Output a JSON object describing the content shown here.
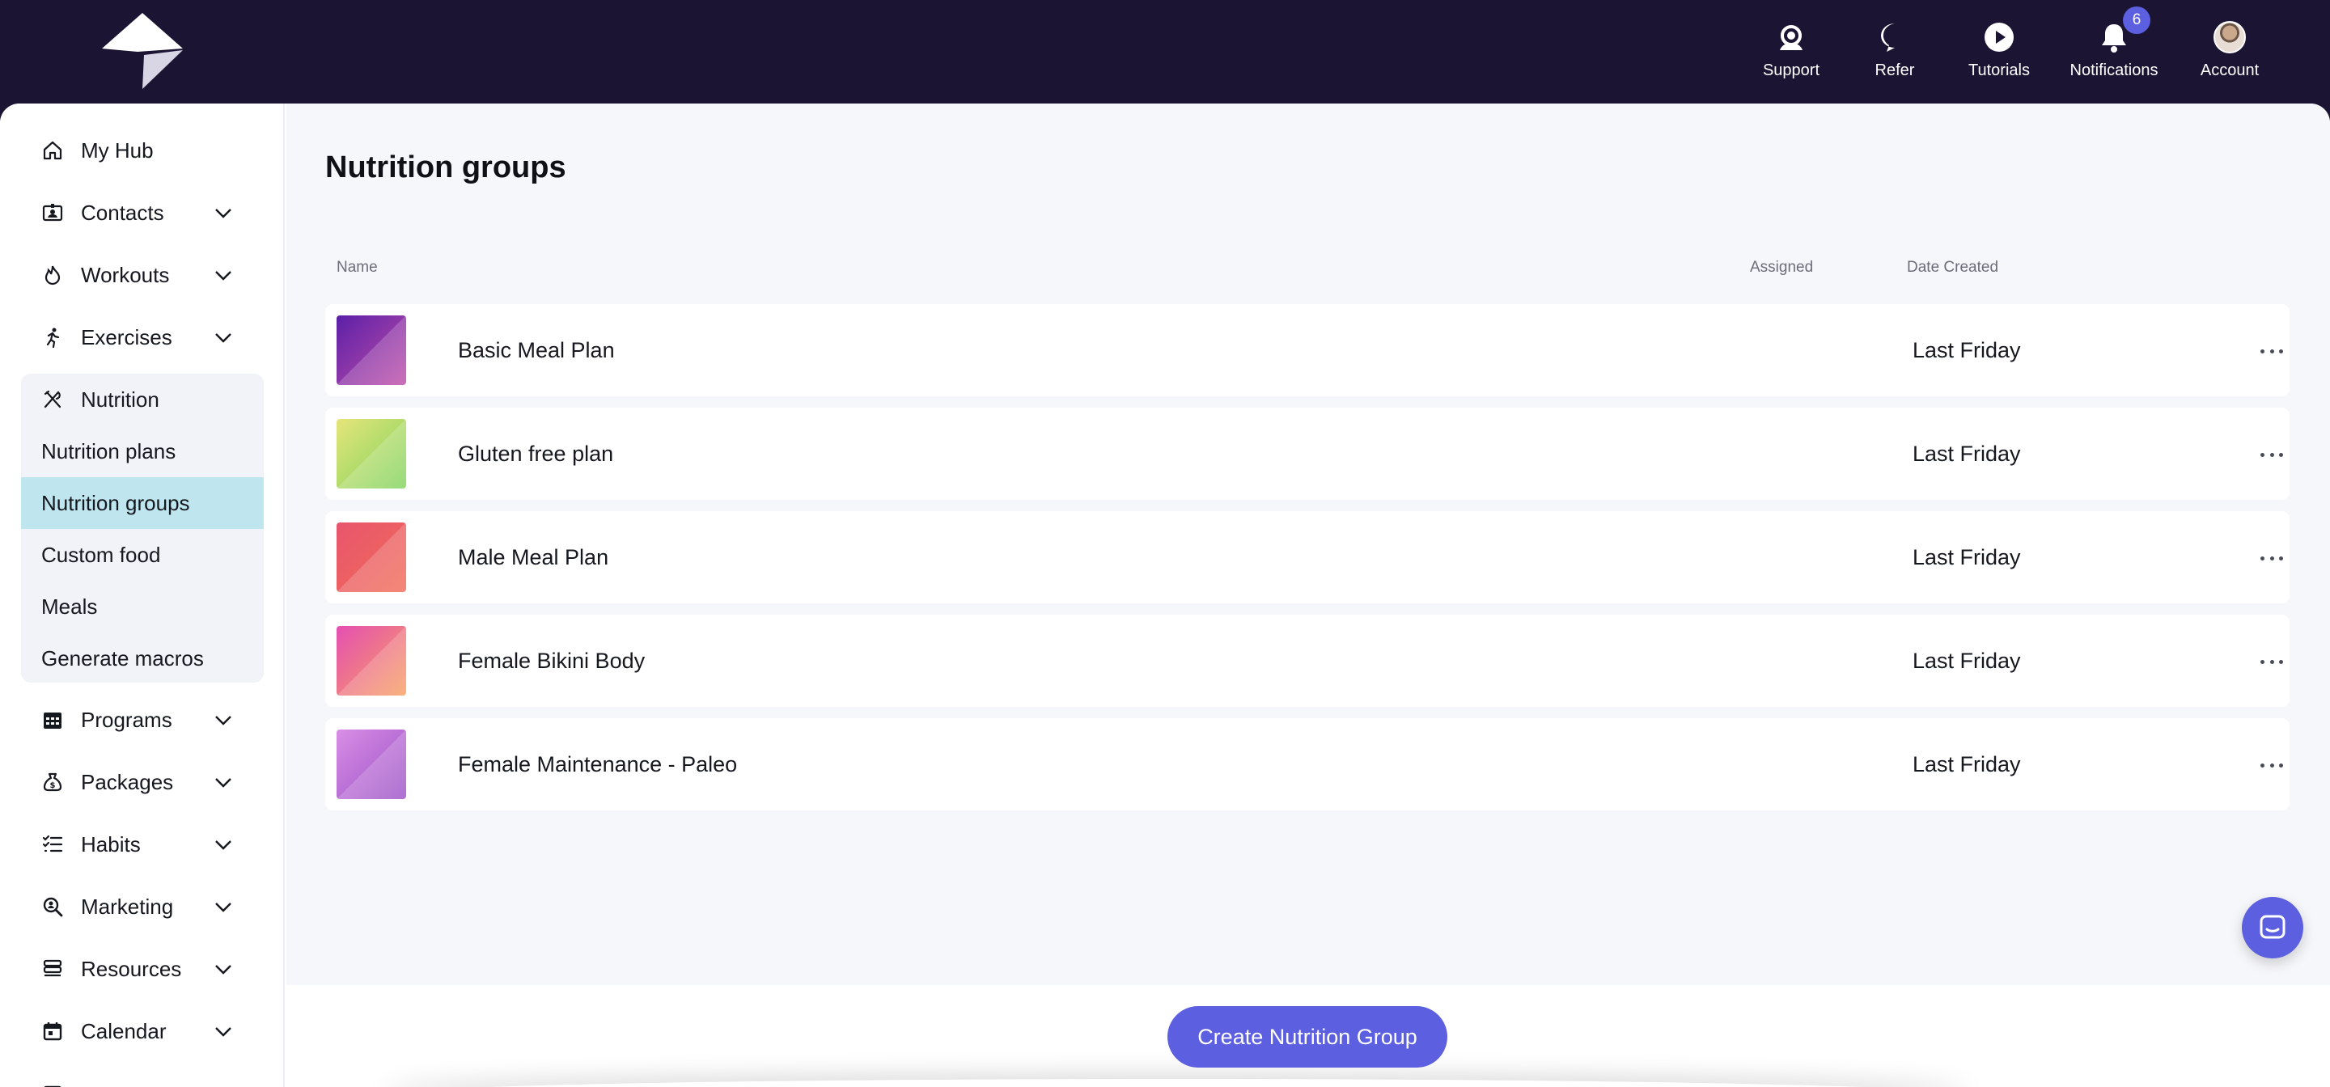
{
  "header": {
    "nav": [
      {
        "key": "support",
        "label": "Support",
        "icon": "headset-icon"
      },
      {
        "key": "refer",
        "label": "Refer",
        "icon": "dollar-chat-icon"
      },
      {
        "key": "tutorials",
        "label": "Tutorials",
        "icon": "play-circle-icon"
      },
      {
        "key": "notifications",
        "label": "Notifications",
        "icon": "bell-icon",
        "badge": "6"
      },
      {
        "key": "account",
        "label": "Account",
        "icon": "avatar"
      }
    ]
  },
  "sidebar": {
    "items": [
      {
        "label": "My Hub",
        "icon": "home-icon"
      },
      {
        "label": "Contacts",
        "icon": "contact-card-icon"
      },
      {
        "label": "Workouts",
        "icon": "flame-icon"
      },
      {
        "label": "Exercises",
        "icon": "runner-icon"
      },
      {
        "label": "Nutrition",
        "icon": "utensils-icon"
      },
      {
        "label": "Programs",
        "icon": "calendar-grid-icon"
      },
      {
        "label": "Packages",
        "icon": "moneybag-icon"
      },
      {
        "label": "Habits",
        "icon": "checklist-icon"
      },
      {
        "label": "Marketing",
        "icon": "magnify-icon"
      },
      {
        "label": "Resources",
        "icon": "stack-icon"
      },
      {
        "label": "Calendar",
        "icon": "calendar-icon"
      }
    ],
    "nutrition_sub": [
      "Nutrition plans",
      "Nutrition groups",
      "Custom food",
      "Meals",
      "Generate macros"
    ],
    "active_sub": "Nutrition groups"
  },
  "main": {
    "title": "Nutrition groups",
    "columns": {
      "name": "Name",
      "assigned": "Assigned",
      "date_created": "Date Created"
    },
    "rows": [
      {
        "name": "Basic Meal Plan",
        "assigned": "",
        "date": "Last Friday",
        "colors": [
          "#5b1fa8",
          "#c050a8"
        ]
      },
      {
        "name": "Gluten free plan",
        "assigned": "",
        "date": "Last Friday",
        "colors": [
          "#e6e57a",
          "#7fd35e"
        ]
      },
      {
        "name": "Male Meal Plan",
        "assigned": "",
        "date": "Last Friday",
        "colors": [
          "#e8556e",
          "#f06c58"
        ]
      },
      {
        "name": "Female Bikini Body",
        "assigned": "",
        "date": "Last Friday",
        "colors": [
          "#e54fb3",
          "#f7a160"
        ]
      },
      {
        "name": "Female Maintenance - Paleo",
        "assigned": "",
        "date": "Last Friday",
        "colors": [
          "#d98ee6",
          "#9c52c6"
        ]
      }
    ]
  },
  "footer": {
    "create_label": "Create Nutrition Group"
  },
  "colors": {
    "topbar": "#1b1433",
    "accent": "#5b5fe0",
    "active_sub": "#bfe6ee"
  }
}
